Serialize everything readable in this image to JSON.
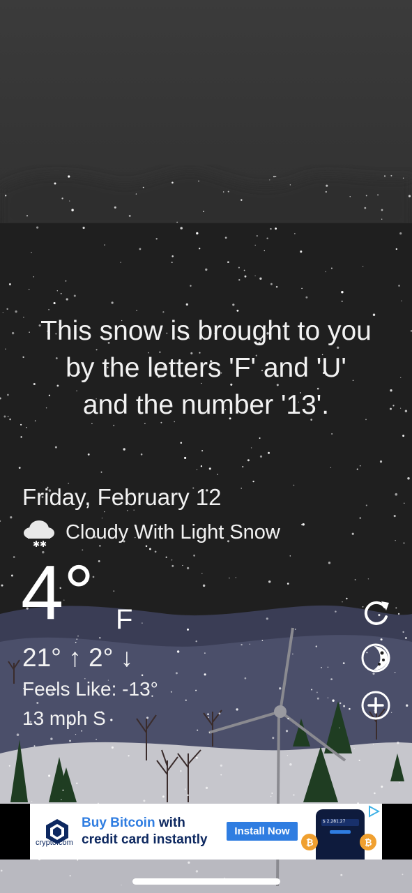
{
  "app": {
    "quote_lines": [
      "This snow is brought to you",
      "by the letters 'F' and 'U'",
      "and the number '13'."
    ]
  },
  "weather": {
    "date": "Friday, February 12",
    "condition": "Cloudy With Light Snow",
    "condition_icon": "cloud-snow-icon",
    "temperature": "4°",
    "unit": "F",
    "hi_lo": "21° ↑ 2° ↓",
    "feels_like": "Feels Like: -13°",
    "wind": "13 mph S"
  },
  "controls": {
    "refresh_icon": "refresh-icon",
    "theme_icon": "moon-cookie-icon",
    "add_icon": "add-location-icon"
  },
  "ad": {
    "headline_highlight": "Buy Bitcoin",
    "headline_rest": " with",
    "headline_line2": "credit card instantly",
    "brand": "crypto.com",
    "cta": "Install Now",
    "phone_balance": "$ 2,281.27"
  },
  "colors": {
    "sky_top": "#3c3c3c",
    "night": "#202020",
    "snow_ground": "#c8c8ce",
    "ad_accent": "#2f7de1",
    "ad_navy": "#0d2860"
  }
}
